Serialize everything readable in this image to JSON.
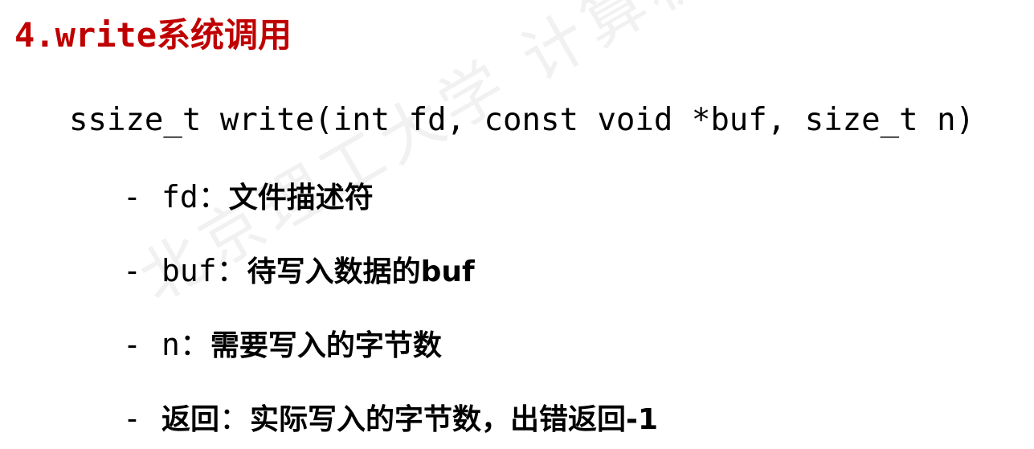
{
  "title": "4.write系统调用",
  "signature": "ssize_t write(int fd, const void *buf, size_t n)",
  "watermark": "北京理工大学 计算机系统 高",
  "params": [
    {
      "dash": "-",
      "key": "fd",
      "sep": "：",
      "desc": "文件描述符"
    },
    {
      "dash": "-",
      "key": "buf",
      "sep": "：",
      "desc": "待写入数据的buf"
    },
    {
      "dash": "-",
      "key": "n",
      "sep": "：",
      "desc": "需要写入的字节数"
    },
    {
      "dash": "-",
      "key": "返回",
      "sep": "：",
      "desc": "实际写入的字节数，出错返回-1"
    }
  ],
  "colors": {
    "title": "#c00000",
    "text": "#000000",
    "watermark": "#f1f1f1"
  }
}
